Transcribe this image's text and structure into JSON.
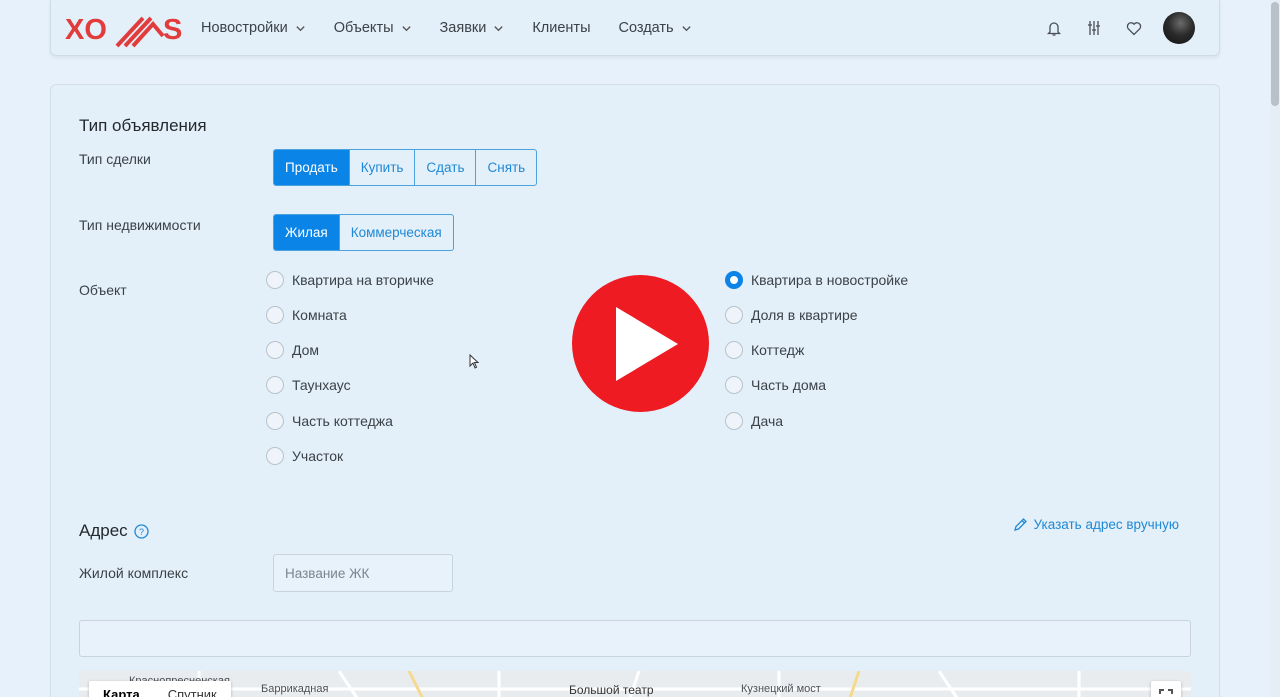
{
  "logo": {
    "text_left": "XO",
    "text_right": "S",
    "color": "#e23b3b"
  },
  "nav": {
    "items": [
      {
        "label": "Новостройки",
        "has_dropdown": true
      },
      {
        "label": "Объекты",
        "has_dropdown": true
      },
      {
        "label": "Заявки",
        "has_dropdown": true
      },
      {
        "label": "Клиенты",
        "has_dropdown": false
      },
      {
        "label": "Создать",
        "has_dropdown": true
      }
    ],
    "icons": [
      "bell-icon",
      "sliders-icon",
      "heart-icon"
    ]
  },
  "listing_type": {
    "title": "Тип объявления",
    "deal": {
      "label": "Тип сделки",
      "options": [
        "Продать",
        "Купить",
        "Сдать",
        "Снять"
      ],
      "selected": "Продать"
    },
    "property": {
      "label": "Тип недвижимости",
      "options": [
        "Жилая",
        "Коммерческая"
      ],
      "selected": "Жилая"
    },
    "object": {
      "label": "Объект",
      "left_options": [
        "Квартира на вторичке",
        "Комната",
        "Дом",
        "Таунхаус",
        "Часть коттеджа",
        "Участок"
      ],
      "right_options": [
        "Квартира в новостройке",
        "Доля в квартире",
        "Коттедж",
        "Часть дома",
        "Дача"
      ],
      "selected": "Квартира в новостройке"
    }
  },
  "address": {
    "title": "Адрес",
    "manual_link": "Указать адрес вручную",
    "complex_label": "Жилой комплекс",
    "complex_placeholder": "Название ЖК",
    "map": {
      "tabs": [
        "Карта",
        "Спутник"
      ],
      "active_tab": "Карта",
      "labels": [
        "Краснопресненская",
        "Баррикадная",
        "Большой театр",
        "Кузнецкий мост"
      ]
    }
  },
  "colors": {
    "accent": "#0a84e6",
    "play": "#ee1b22",
    "background": "#e6f1fb"
  }
}
